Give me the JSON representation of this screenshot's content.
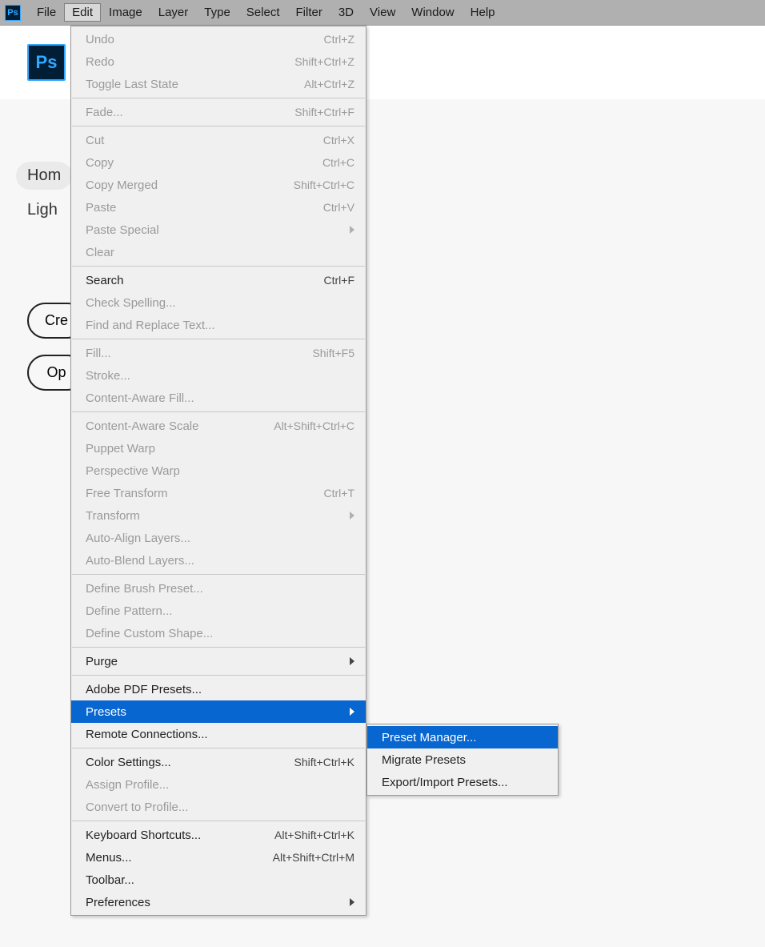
{
  "menubar": {
    "items": [
      "File",
      "Edit",
      "Image",
      "Layer",
      "Type",
      "Select",
      "Filter",
      "3D",
      "View",
      "Window",
      "Help"
    ],
    "open_index": 1
  },
  "app_icon_text": "Ps",
  "sidebar": {
    "items": [
      "Hom",
      "Ligh"
    ],
    "active_index": 0
  },
  "buttons": [
    "Cre",
    "Op"
  ],
  "edit_menu": [
    {
      "type": "item",
      "label": "Undo",
      "shortcut": "Ctrl+Z",
      "disabled": true
    },
    {
      "type": "item",
      "label": "Redo",
      "shortcut": "Shift+Ctrl+Z",
      "disabled": true
    },
    {
      "type": "item",
      "label": "Toggle Last State",
      "shortcut": "Alt+Ctrl+Z",
      "disabled": true
    },
    {
      "type": "sep"
    },
    {
      "type": "item",
      "label": "Fade...",
      "shortcut": "Shift+Ctrl+F",
      "disabled": true
    },
    {
      "type": "sep"
    },
    {
      "type": "item",
      "label": "Cut",
      "shortcut": "Ctrl+X",
      "disabled": true
    },
    {
      "type": "item",
      "label": "Copy",
      "shortcut": "Ctrl+C",
      "disabled": true
    },
    {
      "type": "item",
      "label": "Copy Merged",
      "shortcut": "Shift+Ctrl+C",
      "disabled": true
    },
    {
      "type": "item",
      "label": "Paste",
      "shortcut": "Ctrl+V",
      "disabled": true
    },
    {
      "type": "item",
      "label": "Paste Special",
      "submenu": true,
      "disabled": true
    },
    {
      "type": "item",
      "label": "Clear",
      "disabled": true
    },
    {
      "type": "sep"
    },
    {
      "type": "item",
      "label": "Search",
      "shortcut": "Ctrl+F"
    },
    {
      "type": "item",
      "label": "Check Spelling...",
      "disabled": true
    },
    {
      "type": "item",
      "label": "Find and Replace Text...",
      "disabled": true
    },
    {
      "type": "sep"
    },
    {
      "type": "item",
      "label": "Fill...",
      "shortcut": "Shift+F5",
      "disabled": true
    },
    {
      "type": "item",
      "label": "Stroke...",
      "disabled": true
    },
    {
      "type": "item",
      "label": "Content-Aware Fill...",
      "disabled": true
    },
    {
      "type": "sep"
    },
    {
      "type": "item",
      "label": "Content-Aware Scale",
      "shortcut": "Alt+Shift+Ctrl+C",
      "disabled": true
    },
    {
      "type": "item",
      "label": "Puppet Warp",
      "disabled": true
    },
    {
      "type": "item",
      "label": "Perspective Warp",
      "disabled": true
    },
    {
      "type": "item",
      "label": "Free Transform",
      "shortcut": "Ctrl+T",
      "disabled": true
    },
    {
      "type": "item",
      "label": "Transform",
      "submenu": true,
      "disabled": true
    },
    {
      "type": "item",
      "label": "Auto-Align Layers...",
      "disabled": true
    },
    {
      "type": "item",
      "label": "Auto-Blend Layers...",
      "disabled": true
    },
    {
      "type": "sep"
    },
    {
      "type": "item",
      "label": "Define Brush Preset...",
      "disabled": true
    },
    {
      "type": "item",
      "label": "Define Pattern...",
      "disabled": true
    },
    {
      "type": "item",
      "label": "Define Custom Shape...",
      "disabled": true
    },
    {
      "type": "sep"
    },
    {
      "type": "item",
      "label": "Purge",
      "submenu": true
    },
    {
      "type": "sep"
    },
    {
      "type": "item",
      "label": "Adobe PDF Presets..."
    },
    {
      "type": "item",
      "label": "Presets",
      "submenu": true,
      "highlight": true
    },
    {
      "type": "item",
      "label": "Remote Connections..."
    },
    {
      "type": "sep"
    },
    {
      "type": "item",
      "label": "Color Settings...",
      "shortcut": "Shift+Ctrl+K"
    },
    {
      "type": "item",
      "label": "Assign Profile...",
      "disabled": true
    },
    {
      "type": "item",
      "label": "Convert to Profile...",
      "disabled": true
    },
    {
      "type": "sep"
    },
    {
      "type": "item",
      "label": "Keyboard Shortcuts...",
      "shortcut": "Alt+Shift+Ctrl+K"
    },
    {
      "type": "item",
      "label": "Menus...",
      "shortcut": "Alt+Shift+Ctrl+M"
    },
    {
      "type": "item",
      "label": "Toolbar..."
    },
    {
      "type": "item",
      "label": "Preferences",
      "submenu": true
    }
  ],
  "presets_submenu": [
    {
      "label": "Preset Manager...",
      "highlight": true
    },
    {
      "label": "Migrate Presets"
    },
    {
      "label": "Export/Import Presets..."
    }
  ]
}
